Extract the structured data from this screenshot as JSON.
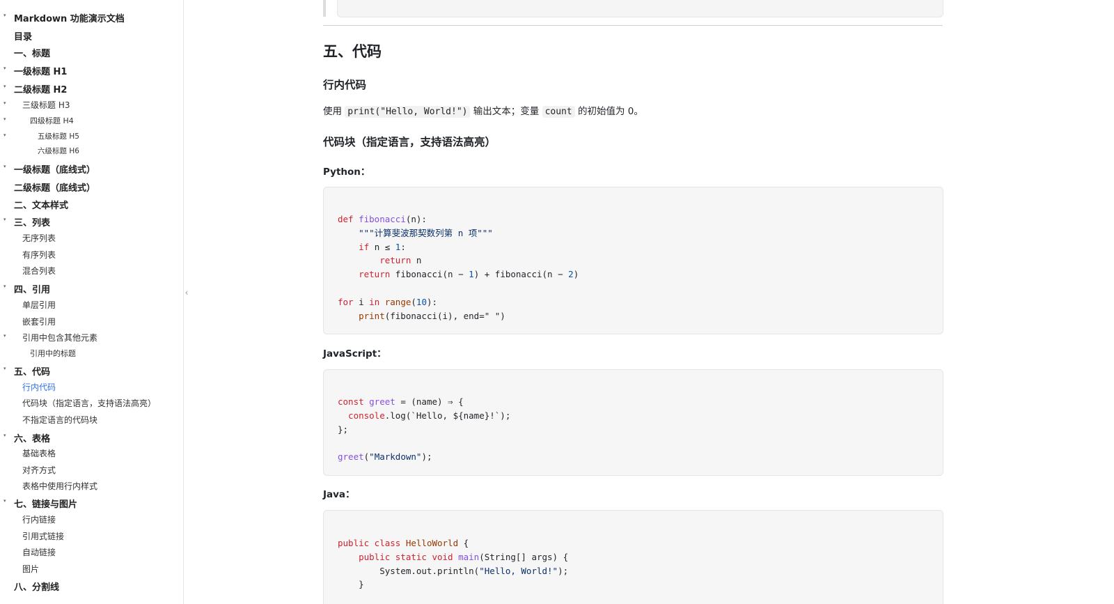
{
  "sidebar": {
    "items": [
      {
        "label": "Markdown 功能演示文档",
        "level": 1,
        "caret": true
      },
      {
        "label": "目录",
        "level": 1,
        "caret": false
      },
      {
        "label": "一、标题",
        "level": 1,
        "caret": false
      },
      {
        "label": "一级标题 H1",
        "level": 1,
        "caret": true
      },
      {
        "label": "二级标题 H2",
        "level": 1,
        "caret": true
      },
      {
        "label": "三级标题 H3",
        "level": 2,
        "caret": true
      },
      {
        "label": "四级标题 H4",
        "level": 3,
        "caret": true
      },
      {
        "label": "五级标题 H5",
        "level": 4,
        "caret": true
      },
      {
        "label": "六级标题 H6",
        "level": 4,
        "caret": false
      },
      {
        "label": "一级标题（底线式）",
        "level": 1,
        "caret": true
      },
      {
        "label": "二级标题（底线式）",
        "level": 1,
        "caret": false
      },
      {
        "label": "二、文本样式",
        "level": 1,
        "caret": false
      },
      {
        "label": "三、列表",
        "level": 1,
        "caret": true
      },
      {
        "label": "无序列表",
        "level": 2,
        "caret": false
      },
      {
        "label": "有序列表",
        "level": 2,
        "caret": false
      },
      {
        "label": "混合列表",
        "level": 2,
        "caret": false
      },
      {
        "label": "四、引用",
        "level": 1,
        "caret": true
      },
      {
        "label": "单层引用",
        "level": 2,
        "caret": false
      },
      {
        "label": "嵌套引用",
        "level": 2,
        "caret": false
      },
      {
        "label": "引用中包含其他元素",
        "level": 2,
        "caret": true
      },
      {
        "label": "引用中的标题",
        "level": 3,
        "caret": false
      },
      {
        "label": "五、代码",
        "level": 1,
        "caret": true
      },
      {
        "label": "行内代码",
        "level": 2,
        "caret": false,
        "active": true
      },
      {
        "label": "代码块（指定语言，支持语法高亮）",
        "level": 2,
        "caret": false
      },
      {
        "label": "不指定语言的代码块",
        "level": 2,
        "caret": false
      },
      {
        "label": "六、表格",
        "level": 1,
        "caret": true
      },
      {
        "label": "基础表格",
        "level": 2,
        "caret": false
      },
      {
        "label": "对齐方式",
        "level": 2,
        "caret": false
      },
      {
        "label": "表格中使用行内样式",
        "level": 2,
        "caret": false
      },
      {
        "label": "七、链接与图片",
        "level": 1,
        "caret": true
      },
      {
        "label": "行内链接",
        "level": 2,
        "caret": false
      },
      {
        "label": "引用式链接",
        "level": 2,
        "caret": false
      },
      {
        "label": "自动链接",
        "level": 2,
        "caret": false
      },
      {
        "label": "图片",
        "level": 2,
        "caret": false
      },
      {
        "label": "八、分割线",
        "level": 1,
        "caret": false
      }
    ],
    "collapse_glyph": "‹"
  },
  "content": {
    "section_title": "五、代码",
    "inline_heading": "行内代码",
    "para": {
      "pre": "使用 ",
      "code1": "print(\"Hello, World!\")",
      "mid": " 输出文本；变量 ",
      "code2": "count",
      "post": " 的初始值为 0。"
    },
    "codeblock_heading": "代码块（指定语言，支持语法高亮）",
    "python_label": "Python：",
    "js_label": "JavaScript：",
    "java_label": "Java：",
    "python_lines": [
      [
        [
          "kw",
          "def "
        ],
        [
          "fn",
          "fibonacci"
        ],
        [
          "",
          "(n):"
        ]
      ],
      [
        [
          "str",
          "    \"\"\"计算斐波那契数列第 n 项\"\"\""
        ]
      ],
      [
        [
          "kw",
          "    if "
        ],
        [
          "",
          "n ≤ "
        ],
        [
          "num",
          "1"
        ],
        [
          "",
          ":"
        ]
      ],
      [
        [
          "kw",
          "        return "
        ],
        [
          "",
          "n"
        ]
      ],
      [
        [
          "kw",
          "    return "
        ],
        [
          "",
          "fibonacci(n − "
        ],
        [
          "num",
          "1"
        ],
        [
          "",
          ") + fibonacci(n − "
        ],
        [
          "num",
          "2"
        ],
        [
          "",
          ")"
        ]
      ],
      [
        [
          "",
          ""
        ]
      ],
      [
        [
          "kw",
          "for "
        ],
        [
          "",
          "i "
        ],
        [
          "kw",
          "in "
        ],
        [
          "bi",
          "range"
        ],
        [
          "",
          "("
        ],
        [
          "num",
          "10"
        ],
        [
          "",
          "):"
        ]
      ],
      [
        [
          "bi",
          "    print"
        ],
        [
          "",
          "(fibonacci(i), end=\" \")"
        ]
      ]
    ],
    "js_lines": [
      [
        [
          "kw",
          "const "
        ],
        [
          "fn",
          "greet"
        ],
        [
          "",
          " = (name) ⇒ {"
        ]
      ],
      [
        [
          "kw",
          "  console"
        ],
        [
          "",
          ".log(`Hello, ${name}!`);"
        ]
      ],
      [
        [
          "",
          "};"
        ]
      ],
      [
        [
          "",
          ""
        ]
      ],
      [
        [
          "fn",
          "greet"
        ],
        [
          "",
          "("
        ],
        [
          "str",
          "\"Markdown\""
        ],
        [
          "",
          ");"
        ]
      ]
    ],
    "java_lines": [
      [
        [
          "kw",
          "public class "
        ],
        [
          "cls",
          "HelloWorld"
        ],
        [
          "",
          " {"
        ]
      ],
      [
        [
          "kw",
          "    public static void "
        ],
        [
          "fn",
          "main"
        ],
        [
          "",
          "(String[] args) {"
        ]
      ],
      [
        [
          "",
          "        System.out.println("
        ],
        [
          "str",
          "\"Hello, World!\""
        ],
        [
          "",
          ");"
        ]
      ],
      [
        [
          "",
          "    }"
        ]
      ]
    ]
  }
}
